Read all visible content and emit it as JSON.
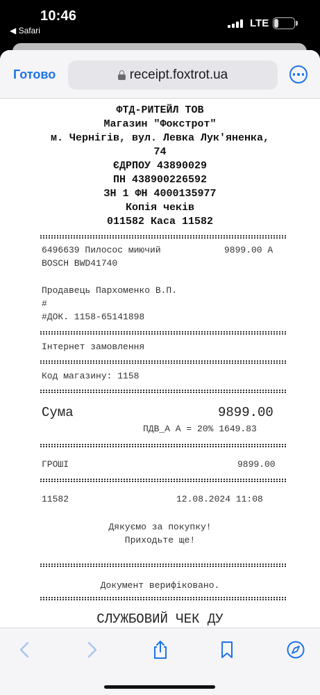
{
  "status": {
    "time": "10:46",
    "back_app": "◀ Safari",
    "network": "LTE",
    "battery": "21",
    "battery_level": 0.21
  },
  "nav": {
    "done_label": "Готово",
    "url": "receipt.foxtrot.ua"
  },
  "receipt": {
    "header": [
      "ФТД-РИТЕЙЛ ТОВ",
      "Магазин \"Фокстрот\"",
      "м. Чернігів, вул. Левка Лук'яненка,",
      "74",
      "ЄДРПОУ 43890029",
      "ПН 438900226592",
      "ЗН 1 ФН 4000135977",
      "Копія чеків",
      "011582 Каса 11582"
    ],
    "item_line1": "6496639 Пилосос миючий",
    "item_price": "9899.00 А",
    "item_line2": "BOSCH BWD41740",
    "seller": "Продавець Пархоменко В.П.",
    "hash": "#",
    "doc": "#ДОК. 1158-65141898",
    "order_type": "Інтернет замовлення",
    "store_code": "Код магазину: 1158",
    "sum_label": "Сума",
    "sum_value": "9899.00",
    "vat": "ПДВ_А А = 20% 1649.83",
    "payment_label": "ГРОШІ",
    "payment_value": "9899.00",
    "check_no": "11582",
    "datetime": "12.08.2024 11:08",
    "thanks1": "Дякуємо за покупку!",
    "thanks2": "Приходьте ще!",
    "verified": "Документ верифіковано.",
    "service": "СЛУЖБОВИЙ ЧЕК ДУ"
  },
  "toolbar": {
    "icons": [
      "back-icon",
      "forward-icon",
      "share-icon",
      "bookmarks-icon",
      "compass-icon"
    ]
  }
}
